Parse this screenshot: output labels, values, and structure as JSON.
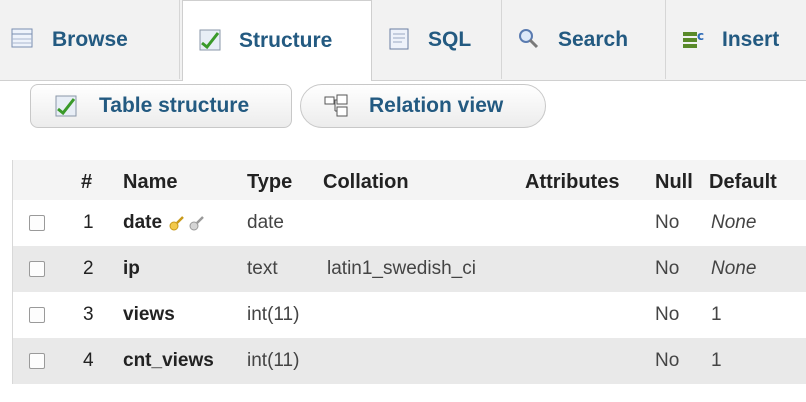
{
  "tabs": [
    {
      "label": "Browse",
      "icon": "browse-table-icon"
    },
    {
      "label": "Structure",
      "icon": "structure-icon",
      "active": true
    },
    {
      "label": "SQL",
      "icon": "sql-icon"
    },
    {
      "label": "Search",
      "icon": "search-icon"
    },
    {
      "label": "Insert",
      "icon": "insert-icon"
    }
  ],
  "subnav": {
    "table_structure": "Table structure",
    "relation_view": "Relation view"
  },
  "columns": {
    "num": "#",
    "name": "Name",
    "type": "Type",
    "collation": "Collation",
    "attributes": "Attributes",
    "null": "Null",
    "default": "Default"
  },
  "rows": [
    {
      "num": "1",
      "name": "date",
      "type": "date",
      "collation": "",
      "attributes": "",
      "null": "No",
      "default": "None",
      "keys": true
    },
    {
      "num": "2",
      "name": "ip",
      "type": "text",
      "collation": "latin1_swedish_ci",
      "attributes": "",
      "null": "No",
      "default": "None"
    },
    {
      "num": "3",
      "name": "views",
      "type": "int(11)",
      "collation": "",
      "attributes": "",
      "null": "No",
      "default": "1"
    },
    {
      "num": "4",
      "name": "cnt_views",
      "type": "int(11)",
      "collation": "",
      "attributes": "",
      "null": "No",
      "default": "1"
    }
  ],
  "colors": {
    "link": "#235a81",
    "row_alt": "#e9e9e9"
  }
}
